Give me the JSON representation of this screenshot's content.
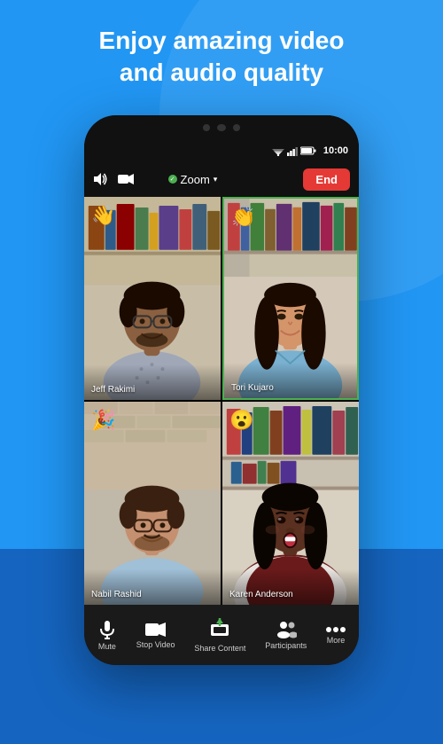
{
  "header": {
    "line1": "Enjoy amazing video",
    "line2": "and audio quality"
  },
  "status_bar": {
    "time": "10:00"
  },
  "zoom_toolbar": {
    "speaker_icon": "🔊",
    "camera_icon": "📷",
    "meeting_name": "Zoom",
    "chevron": "▾",
    "end_label": "End"
  },
  "participants": [
    {
      "name": "Jeff Rakimi",
      "emoji": "👋",
      "position": "top-left",
      "active": false,
      "skin_color": "#8B6040",
      "shirt_color": "#b0b8c8",
      "bg_top": "#c8b090",
      "bg_bottom": "#7a5a38"
    },
    {
      "name": "Tori Kujaro",
      "emoji": "👏",
      "position": "top-right",
      "active": true,
      "skin_color": "#D4956A",
      "shirt_color": "#7ab0d0",
      "bg_top": "#e0c8b0",
      "bg_bottom": "#8a6040"
    },
    {
      "name": "Nabil Rashid",
      "emoji": "🎉",
      "position": "bottom-left",
      "active": false,
      "skin_color": "#C49070",
      "shirt_color": "#a0c0d8",
      "bg_top": "#d4bca0",
      "bg_bottom": "#7a5840"
    },
    {
      "name": "Karen Anderson",
      "emoji": "😮",
      "position": "bottom-right",
      "active": false,
      "skin_color": "#8B5A38",
      "shirt_color": "#8B2020",
      "bg_top": "#c09070",
      "bg_bottom": "#4a2810"
    }
  ],
  "bottom_toolbar": {
    "buttons": [
      {
        "label": "Mute",
        "icon": "mic"
      },
      {
        "label": "Stop Video",
        "icon": "video"
      },
      {
        "label": "Share Content",
        "icon": "share"
      },
      {
        "label": "Participants",
        "icon": "people"
      },
      {
        "label": "More",
        "icon": "dots"
      }
    ]
  }
}
